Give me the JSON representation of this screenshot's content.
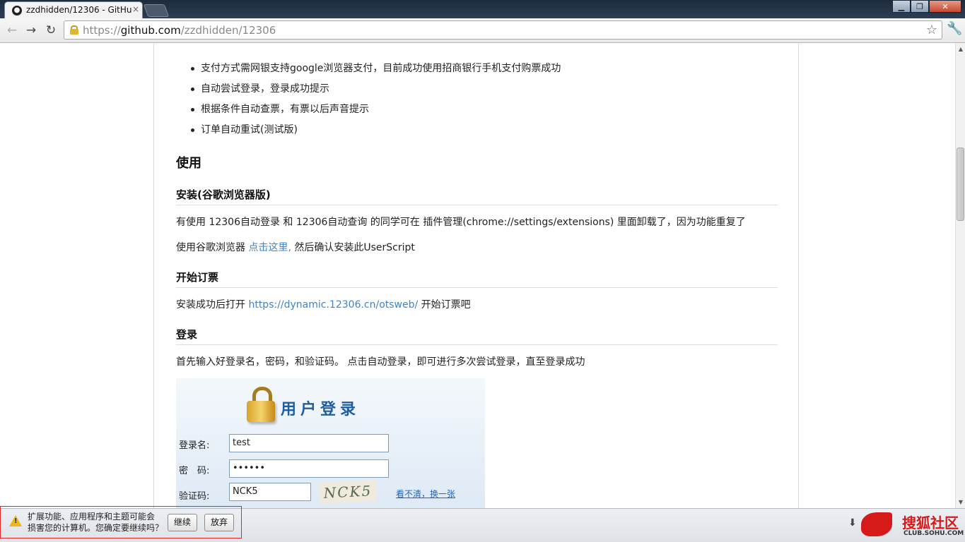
{
  "browser": {
    "tab_title": "zzdhidden/12306 - GitHu",
    "tab_close": "×",
    "url_scheme": "https://",
    "url_host": "github.com",
    "url_path": "/zzdhidden/12306"
  },
  "features": [
    "支付方式需网银支持google浏览器支付，目前成功使用招商银行手机支付购票成功",
    "自动尝试登录，登录成功提示",
    "根据条件自动查票，有票以后声音提示",
    "订单自动重试(测试版)"
  ],
  "usage": {
    "heading": "使用",
    "install_heading": "安装(谷歌浏览器版)",
    "install_para": "有使用 12306自动登录 和 12306自动查询 的同学可在 插件管理(chrome://settings/extensions) 里面卸载了，因为功能重复了",
    "install_line_prefix": "使用谷歌浏览器 ",
    "install_link": "点击这里,",
    "install_line_suffix": " 然后确认安装此UserScript",
    "order_heading": "开始订票",
    "order_prefix": "安装成功后打开 ",
    "order_link": "https://dynamic.12306.cn/otsweb/",
    "order_suffix": " 开始订票吧",
    "login_heading": "登录",
    "login_para": "首先输入好登录名，密码，和验证码。 点击自动登录，即可进行多次尝试登录，直至登录成功"
  },
  "login_image": {
    "title": "用户登录",
    "username_label": "登录名:",
    "username_value": "test",
    "password_label": "密　码:",
    "password_value": "••••••",
    "captcha_label": "验证码:",
    "captcha_value": "NCK5",
    "captcha_image_text": "NCK5",
    "refresh_link": "看不清，换一张"
  },
  "download_bar": {
    "warning_line1": "扩展功能、应用程序和主题可能会",
    "warning_line2": "损害您的计算机。您确定要继续吗？",
    "continue_label": "继续",
    "discard_label": "放弃"
  },
  "watermark": {
    "name": "搜狐社区",
    "url": "CLUB.SOHU.COM"
  }
}
